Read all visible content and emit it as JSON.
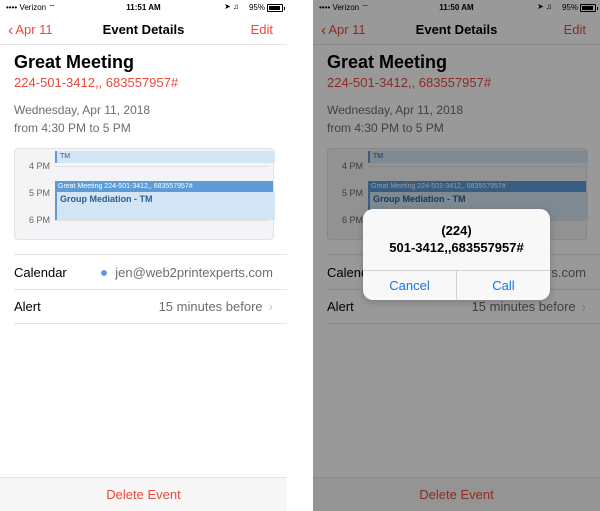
{
  "screens": [
    {
      "status": {
        "carrier": "Verizon",
        "time": "11:51 AM",
        "battery": "95%"
      },
      "nav": {
        "back": "Apr 11",
        "title": "Event Details",
        "edit": "Edit"
      },
      "event": {
        "title": "Great Meeting",
        "phone": "224-501-3412,, 683557957#",
        "date": "Wednesday, Apr 11, 2018",
        "time": "from 4:30 PM to 5 PM"
      },
      "mini_calendar": {
        "hours": [
          "4 PM",
          "5 PM",
          "6 PM"
        ],
        "blocks": [
          "TM",
          "Great Meeting 224-501-3412,, 683557957#",
          "Group Mediation - TM"
        ]
      },
      "rows": [
        {
          "label": "Calendar",
          "value": "jen@web2printexperts.com"
        },
        {
          "label": "Alert",
          "value": "15 minutes before"
        }
      ],
      "bottom": "Delete Event"
    },
    {
      "status": {
        "carrier": "Verizon",
        "time": "11:50 AM",
        "battery": "95%"
      },
      "nav": {
        "back": "Apr 11",
        "title": "Event Details",
        "edit": "Edit"
      },
      "event": {
        "title": "Great Meeting",
        "phone": "224-501-3412,, 683557957#",
        "date": "Wednesday, Apr 11, 2018",
        "time": "from 4:30 PM to 5 PM"
      },
      "mini_calendar": {
        "hours": [
          "4 PM",
          "5 PM",
          "6 PM"
        ],
        "blocks": [
          "TM",
          "Great Meeting 224-501-3412,, 683557957#",
          "Group Mediation - TM"
        ]
      },
      "rows": [
        {
          "label": "Calend",
          "value": "s.com"
        },
        {
          "label": "Alert",
          "value": "15 minutes before"
        }
      ],
      "bottom": "Delete Event",
      "alert": {
        "line1": "(224)",
        "line2": "501-3412,,683557957#",
        "cancel": "Cancel",
        "call": "Call"
      }
    }
  ],
  "colors": {
    "accent": "#e84a3b",
    "link": "#1a73e8",
    "event_blue": "#5c9bd6"
  },
  "icons": [
    "wifi-icon",
    "location-icon",
    "alarm-icon",
    "headphones-icon",
    "battery-icon",
    "chevron-left-icon",
    "chevron-right-icon"
  ]
}
